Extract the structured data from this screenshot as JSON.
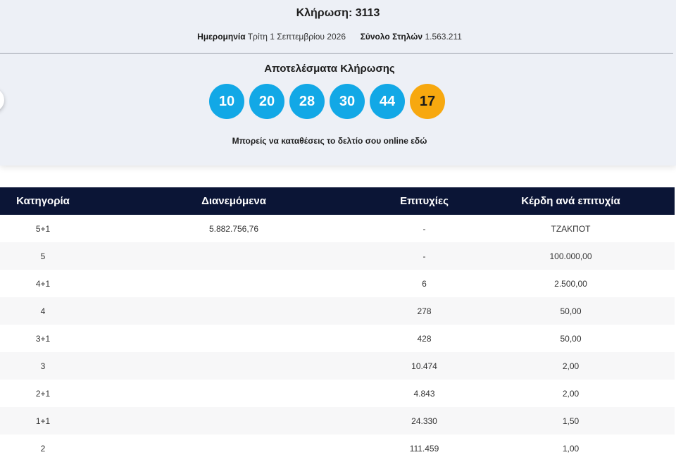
{
  "draw": {
    "title": "Κλήρωση: 3113",
    "date_label": "Ημερομηνία",
    "date_value": "Τρίτη 1 Σεπτεμβρίου 2026",
    "columns_label": "Σύνολο Στηλών",
    "columns_value": "1.563.211"
  },
  "results": {
    "title": "Αποτελέσματα Κλήρωσης",
    "numbers": [
      "10",
      "20",
      "28",
      "30",
      "44"
    ],
    "joker": "17",
    "cta": "Μπορείς να καταθέσεις το δελτίο σου online εδώ",
    "colors": {
      "ball": "#12a8e6",
      "joker": "#f7a80f",
      "header": "#0b1536"
    }
  },
  "table": {
    "headers": [
      "Κατηγορία",
      "Διανεμόμενα",
      "Επιτυχίες",
      "Κέρδη ανά επιτυχία"
    ],
    "rows": [
      [
        "5+1",
        "5.882.756,76",
        "-",
        "ΤΖΑΚΠΟΤ"
      ],
      [
        "5",
        "",
        "-",
        "100.000,00"
      ],
      [
        "4+1",
        "",
        "6",
        "2.500,00"
      ],
      [
        "4",
        "",
        "278",
        "50,00"
      ],
      [
        "3+1",
        "",
        "428",
        "50,00"
      ],
      [
        "3",
        "",
        "10.474",
        "2,00"
      ],
      [
        "2+1",
        "",
        "4.843",
        "2,00"
      ],
      [
        "1+1",
        "",
        "24.330",
        "1,50"
      ],
      [
        "2",
        "",
        "111.459",
        "1,00"
      ]
    ]
  }
}
